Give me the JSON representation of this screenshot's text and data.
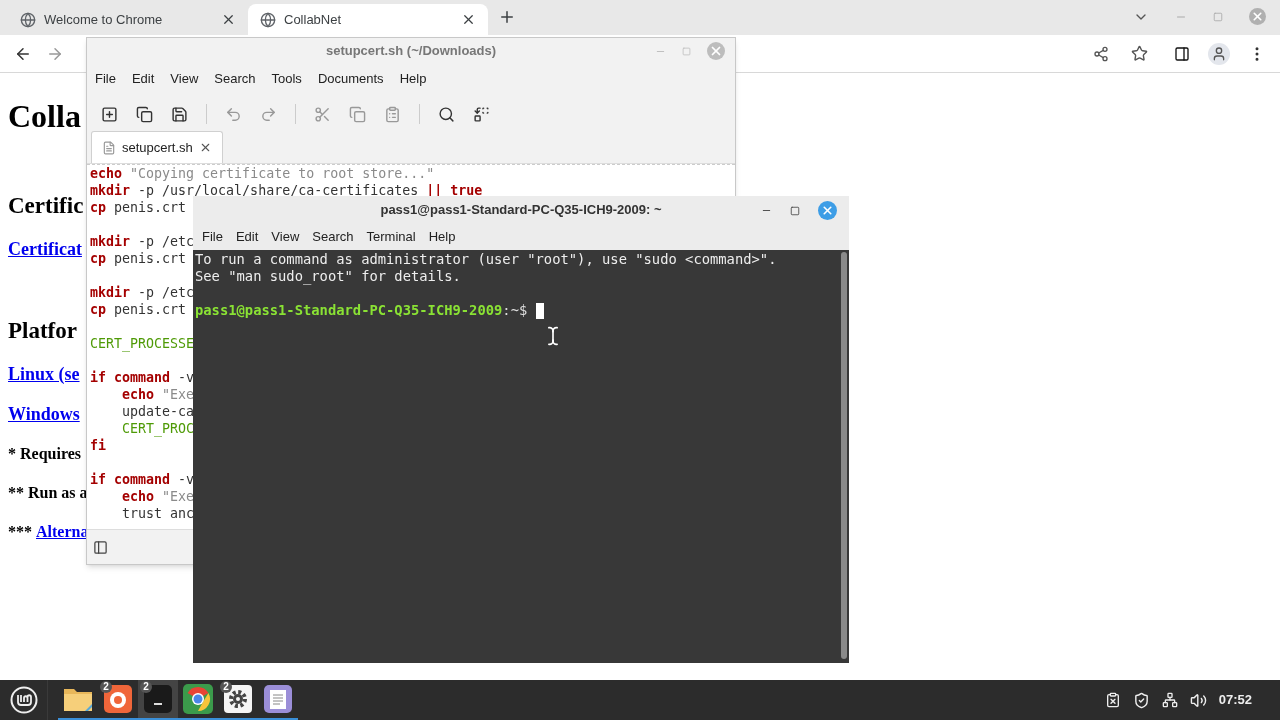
{
  "browser": {
    "tabs": [
      {
        "title": "Welcome to Chrome",
        "selected": false
      },
      {
        "title": "CollabNet",
        "selected": true
      }
    ],
    "page": [
      {
        "kind": "h1",
        "text": "Colla"
      },
      {
        "kind": "h2",
        "text": "Certific"
      },
      {
        "kind": "link",
        "text": "Certificat"
      },
      {
        "kind": "h2",
        "text": "Platfor"
      },
      {
        "kind": "link",
        "text": "Linux (se"
      },
      {
        "kind": "link",
        "text": "Windows"
      },
      {
        "kind": "note",
        "text": "* Requires"
      },
      {
        "kind": "note",
        "text": "** Run as a"
      },
      {
        "kind": "note",
        "text": "***",
        "link": "Alterna"
      }
    ]
  },
  "editor": {
    "title": "setupcert.sh (~/Downloads)",
    "menu": [
      "File",
      "Edit",
      "View",
      "Search",
      "Tools",
      "Documents",
      "Help"
    ],
    "tab": "setupcert.sh",
    "lines": [
      {
        "blank_before": false,
        "indented": false,
        "tokens": [
          {
            "kind": "keyword",
            "t": "echo"
          },
          {
            "kind": "string",
            "t": "\"Copying certificate to root store...\""
          }
        ]
      },
      {
        "blank_before": false,
        "indented": false,
        "tokens": [
          {
            "kind": "keyword",
            "t": "mkdir"
          },
          {
            "kind": "plain",
            "t": "-p /usr/local/share/ca-certificates"
          },
          {
            "kind": "keyword",
            "t": "|| true"
          }
        ]
      },
      {
        "blank_before": false,
        "indented": false,
        "tokens": [
          {
            "kind": "keyword",
            "t": "cp"
          },
          {
            "kind": "plain",
            "t": "penis.crt"
          }
        ]
      },
      {
        "blank_before": true,
        "indented": false,
        "tokens": [
          {
            "kind": "keyword",
            "t": "mkdir"
          },
          {
            "kind": "plain",
            "t": "-p /etc"
          }
        ]
      },
      {
        "blank_before": false,
        "indented": false,
        "tokens": [
          {
            "kind": "keyword",
            "t": "cp"
          },
          {
            "kind": "plain",
            "t": "penis.crt"
          }
        ]
      },
      {
        "blank_before": true,
        "indented": false,
        "tokens": [
          {
            "kind": "keyword",
            "t": "mkdir"
          },
          {
            "kind": "plain",
            "t": "-p /etc"
          }
        ]
      },
      {
        "blank_before": false,
        "indented": false,
        "tokens": [
          {
            "kind": "keyword",
            "t": "cp"
          },
          {
            "kind": "plain",
            "t": "penis.crt"
          }
        ]
      },
      {
        "blank_before": true,
        "indented": false,
        "tokens": [
          {
            "kind": "variable",
            "t": "CERT_PROCESSE"
          }
        ]
      },
      {
        "blank_before": true,
        "indented": false,
        "tokens": [
          {
            "kind": "keyword",
            "t": "if command"
          },
          {
            "kind": "plain",
            "t": "-v"
          }
        ]
      },
      {
        "blank_before": false,
        "indented": true,
        "tokens": [
          {
            "kind": "keyword",
            "t": "echo"
          },
          {
            "kind": "string",
            "t": "\"Exe"
          }
        ]
      },
      {
        "blank_before": false,
        "indented": true,
        "tokens": [
          {
            "kind": "plain",
            "t": "update-ca"
          }
        ]
      },
      {
        "blank_before": false,
        "indented": true,
        "tokens": [
          {
            "kind": "variable",
            "t": "CERT_PROC"
          }
        ]
      },
      {
        "blank_before": false,
        "indented": false,
        "tokens": [
          {
            "kind": "keyword",
            "t": "fi"
          }
        ]
      },
      {
        "blank_before": true,
        "indented": false,
        "tokens": [
          {
            "kind": "keyword",
            "t": "if command"
          },
          {
            "kind": "plain",
            "t": "-v"
          }
        ]
      },
      {
        "blank_before": false,
        "indented": true,
        "tokens": [
          {
            "kind": "keyword",
            "t": "echo"
          },
          {
            "kind": "string",
            "t": "\"Exe"
          }
        ]
      },
      {
        "blank_before": false,
        "indented": true,
        "tokens": [
          {
            "kind": "plain",
            "t": "trust anc"
          }
        ]
      }
    ]
  },
  "terminal": {
    "title": "pass1@pass1-Standard-PC-Q35-ICH9-2009: ~",
    "menu": [
      "File",
      "Edit",
      "View",
      "Search",
      "Terminal",
      "Help"
    ],
    "output": [
      "To run a command as administrator (user \"root\"), use \"sudo <command>\".",
      "See \"man sudo_root\" for details."
    ],
    "prompt_user": "pass1@pass1-Standard-PC-Q35-ICH9-2009",
    "prompt_path": ":~$"
  },
  "taskbar": {
    "apps": [
      {
        "kind": "files",
        "active": false
      },
      {
        "kind": "firefox",
        "badge": "2",
        "active": false
      },
      {
        "kind": "terminal",
        "badge": "2",
        "active": true
      },
      {
        "kind": "chrome",
        "active": false
      },
      {
        "kind": "settings",
        "badge": "2",
        "active": false
      },
      {
        "kind": "editor",
        "active": false
      }
    ],
    "clock": "07:52"
  }
}
